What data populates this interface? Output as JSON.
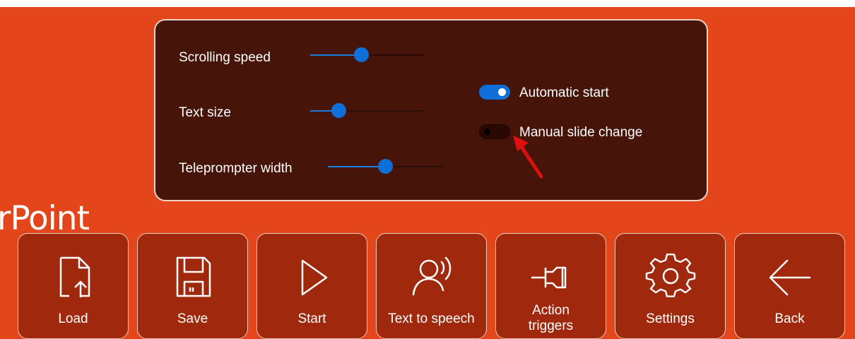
{
  "settings_panel": {
    "sliders": [
      {
        "label": "Scrolling speed",
        "value_pct": 45
      },
      {
        "label": "Text size",
        "value_pct": 25
      },
      {
        "label": "Teleprompter width",
        "value_pct": 50
      }
    ],
    "toggles": [
      {
        "label": "Automatic start",
        "on": true
      },
      {
        "label": "Manual slide change",
        "on": false
      }
    ]
  },
  "background_title": "rPoint",
  "toolbar": {
    "buttons": [
      {
        "label": "Load",
        "icon": "load-file-icon"
      },
      {
        "label": "Save",
        "icon": "save-disk-icon"
      },
      {
        "label": "Start",
        "icon": "play-icon"
      },
      {
        "label": "Text to speech",
        "icon": "speaker-person-icon"
      },
      {
        "label_line1": "Action",
        "label_line2": "triggers",
        "icon": "pushpin-icon"
      },
      {
        "label": "Settings",
        "icon": "gear-icon"
      },
      {
        "label": "Back",
        "icon": "back-arrow-icon"
      }
    ]
  },
  "colors": {
    "background": "#e2461a",
    "panel": "#461409",
    "accent": "#0e6fd8",
    "button": "#a0290d",
    "annotation_arrow": "#e01010"
  }
}
